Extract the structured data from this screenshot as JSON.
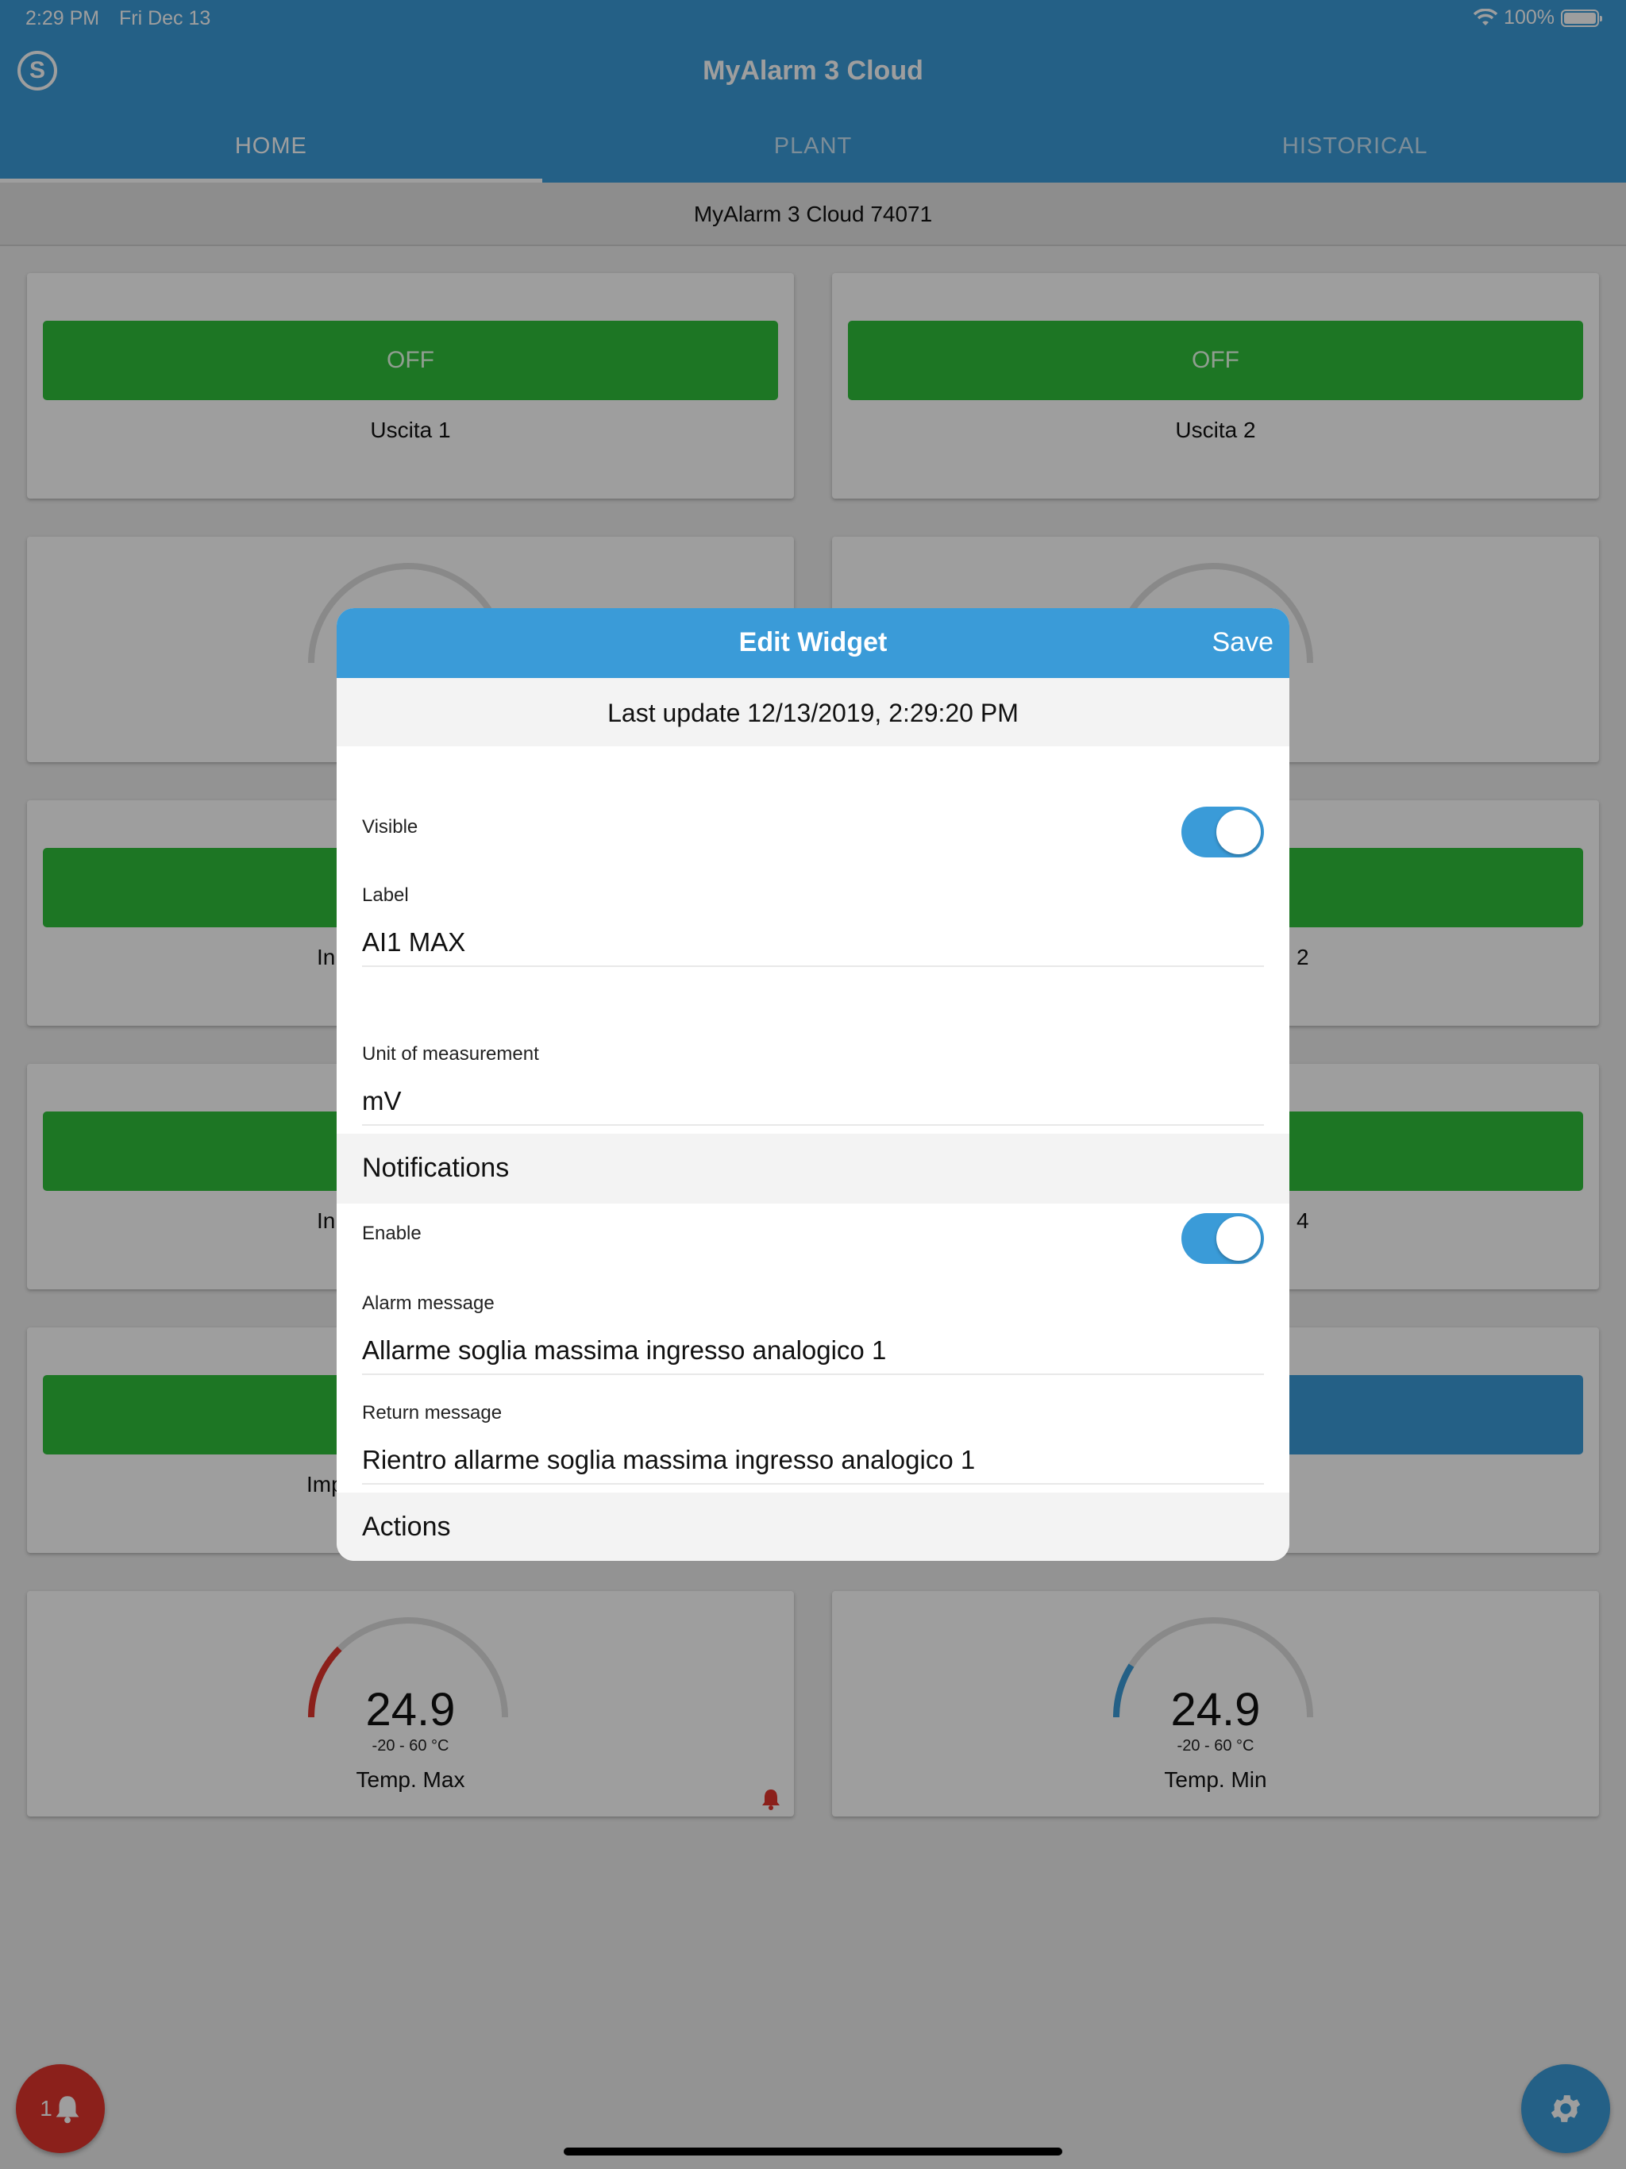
{
  "status_bar": {
    "time": "2:29 PM",
    "date": "Fri Dec 13",
    "battery": "100%"
  },
  "app": {
    "title": "MyAlarm 3 Cloud",
    "logo_letter": "S"
  },
  "tabs": [
    {
      "label": "HOME",
      "active": true
    },
    {
      "label": "PLANT",
      "active": false
    },
    {
      "label": "HISTORICAL",
      "active": false
    }
  ],
  "device_name": "MyAlarm 3 Cloud 74071",
  "widgets": {
    "output1": {
      "state": "OFF",
      "label": "Uscita 1"
    },
    "output2": {
      "state": "OFF",
      "label": "Uscita 2"
    },
    "row3_left_label_fragment": "In",
    "row3_right_label_fragment": "2",
    "row4_left_label_fragment": "In",
    "row4_right_label_fragment": "4",
    "row5_left_label_fragment": "Imp",
    "temp_max": {
      "value": "24.9",
      "range": "-20 - 60 °C",
      "label": "Temp. Max",
      "level": 0.25,
      "color": "#e0342c"
    },
    "temp_min": {
      "value": "24.9",
      "range": "-20 - 60 °C",
      "label": "Temp. Min",
      "level": 0.18,
      "color": "#3a9bd8"
    }
  },
  "fab": {
    "alarm_count": "1",
    "alarm_color": "#e0342c",
    "settings_color": "#3a9bd8"
  },
  "modal": {
    "title": "Edit Widget",
    "save_label": "Save",
    "last_update": "Last update 12/13/2019, 2:29:20 PM",
    "visible_label": "Visible",
    "visible_on": true,
    "label_label": "Label",
    "label_value": "AI1 MAX",
    "unit_label": "Unit of measurement",
    "unit_value": "mV",
    "notifications_section": "Notifications",
    "enable_label": "Enable",
    "enable_on": true,
    "alarm_message_label": "Alarm message",
    "alarm_message_value": "Allarme soglia massima ingresso analogico 1",
    "return_message_label": "Return message",
    "return_message_value": "Rientro allarme soglia massima ingresso analogico 1",
    "actions_section": "Actions"
  },
  "colors": {
    "primary": "#3a9bd8",
    "green": "#2fbf3a",
    "alarm": "#e0342c"
  }
}
